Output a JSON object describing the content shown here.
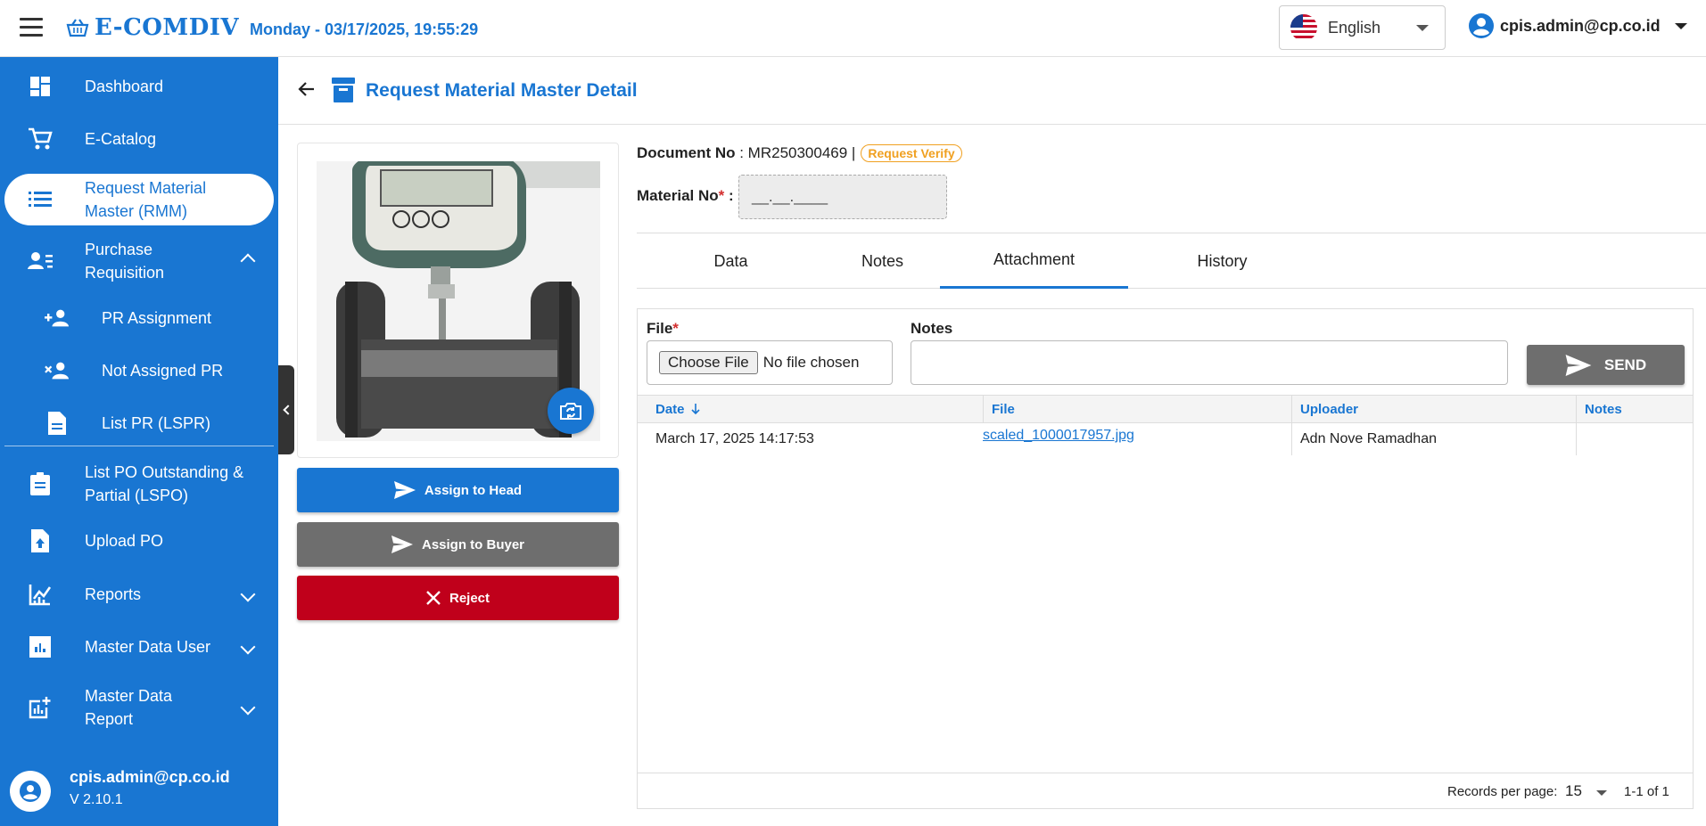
{
  "header": {
    "brand": "E-COMDIV",
    "datetime": "Monday - 03/17/2025, 19:55:29",
    "language": "English",
    "user_email": "cpis.admin@cp.co.id"
  },
  "sidebar": {
    "items": [
      {
        "label": "Dashboard",
        "icon": "dashboard-icon"
      },
      {
        "label": "E-Catalog",
        "icon": "cart-icon"
      },
      {
        "label": "Request Material Master (RMM)",
        "icon": "list-icon",
        "active": true
      },
      {
        "label": "Purchase Requisition",
        "icon": "person-list-icon",
        "expanded": true
      },
      {
        "label": "PR Assignment",
        "icon": "person-add-icon"
      },
      {
        "label": "Not Assigned PR",
        "icon": "person-remove-icon"
      },
      {
        "label": "List PR (LSPR)",
        "icon": "document-icon"
      },
      {
        "label": "List PO Outstanding & Partial (LSPO)",
        "icon": "clipboard-icon"
      },
      {
        "label": "Upload PO",
        "icon": "upload-file-icon"
      },
      {
        "label": "Reports",
        "icon": "chart-icon"
      },
      {
        "label": "Master Data User",
        "icon": "bar-chart-icon"
      },
      {
        "label": "Master Data Report",
        "icon": "chart-add-icon"
      }
    ],
    "footer_email": "cpis.admin@cp.co.id",
    "version": "V 2.10.1"
  },
  "page": {
    "title": "Request Material Master Detail"
  },
  "actions": {
    "assign_head": "Assign to Head",
    "assign_buyer": "Assign to Buyer",
    "reject": "Reject"
  },
  "document": {
    "doc_label": "Document No",
    "doc_no": "MR250300469",
    "status": "Request Verify",
    "material_label": "Material No",
    "material_value": "__.__.____"
  },
  "tabs": [
    "Data",
    "Notes",
    "Attachment",
    "History"
  ],
  "active_tab": "Attachment",
  "attachment": {
    "file_label": "File",
    "choose_file": "Choose File",
    "no_file": "No file chosen",
    "notes_label": "Notes",
    "send": "SEND",
    "columns": [
      "Date",
      "File",
      "Uploader",
      "Notes"
    ],
    "rows": [
      {
        "date": "March 17, 2025 14:17:53",
        "file": "scaled_1000017957.jpg",
        "uploader": "Adn Nove Ramadhan",
        "notes": ""
      }
    ],
    "records_per_page_label": "Records per page:",
    "records_per_page": "15",
    "range": "1-1 of 1"
  },
  "colors": {
    "primary": "#1976d2",
    "reject": "#c0001b",
    "neutral": "#6e6e6e",
    "status": "#f0a020"
  }
}
